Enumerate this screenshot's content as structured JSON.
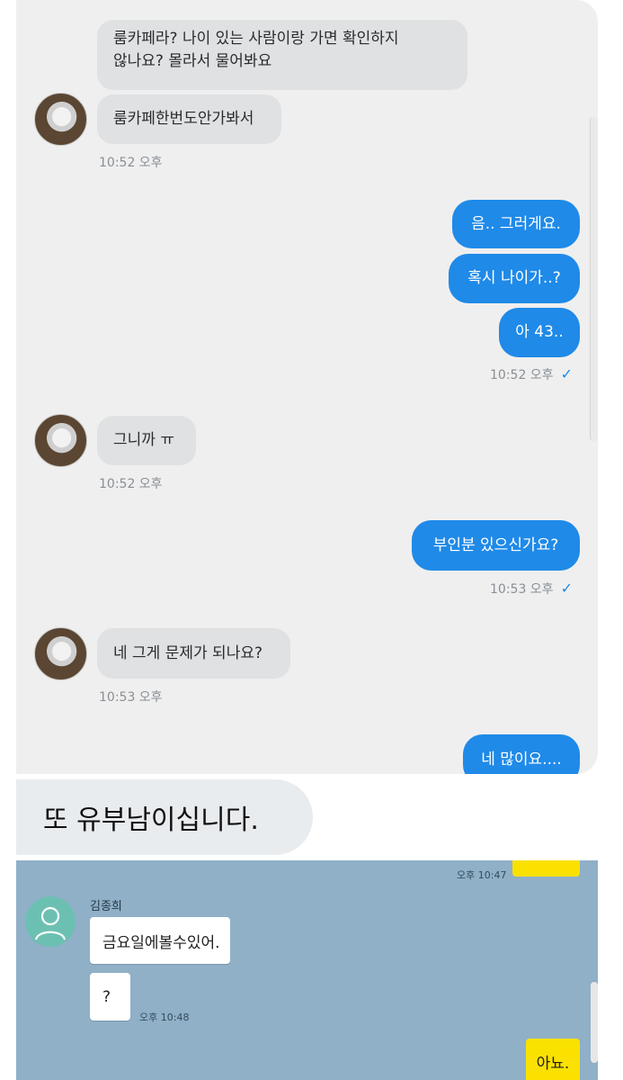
{
  "top_chat": {
    "messages": [
      {
        "direction": "in",
        "text_line1": "룸카페라? 나이 있는 사람이랑 가면 확인하지",
        "text_line2": "않나요? 몰라서 물어봐요"
      },
      {
        "direction": "in",
        "text": "룸카페한번도안가봐서",
        "time": "10:52 오후"
      },
      {
        "direction": "out",
        "text": "음.. 그러게요."
      },
      {
        "direction": "out",
        "text": "혹시 나이가..?"
      },
      {
        "direction": "out",
        "text": "아 43..",
        "time": "10:52 오후"
      },
      {
        "direction": "in",
        "text": "그니까 ㅠ",
        "time": "10:52 오후"
      },
      {
        "direction": "out",
        "text": "부인분 있으신가요?",
        "time": "10:53 오후"
      },
      {
        "direction": "in",
        "text": "네 그게 문제가 되나요?",
        "time": "10:53 오후"
      },
      {
        "direction": "out",
        "text": "네 많이요...."
      }
    ],
    "read_check_glyph": "✓"
  },
  "caption": {
    "text": "또 유부남이십니다."
  },
  "bottom_chat": {
    "top_time": "오후 10:47",
    "sender_name": "김종희",
    "messages": [
      {
        "direction": "in",
        "text": "금요일에볼수있어."
      },
      {
        "direction": "in",
        "text": "?",
        "time": "오후 10:48"
      },
      {
        "direction": "out",
        "text": "아뇨."
      }
    ]
  },
  "colors": {
    "outgoing_bubble": "#1f8ae8",
    "incoming_bubble": "#dfe1e3",
    "kakao_bg": "#8fb0c7",
    "kakao_yellow": "#fae100"
  }
}
